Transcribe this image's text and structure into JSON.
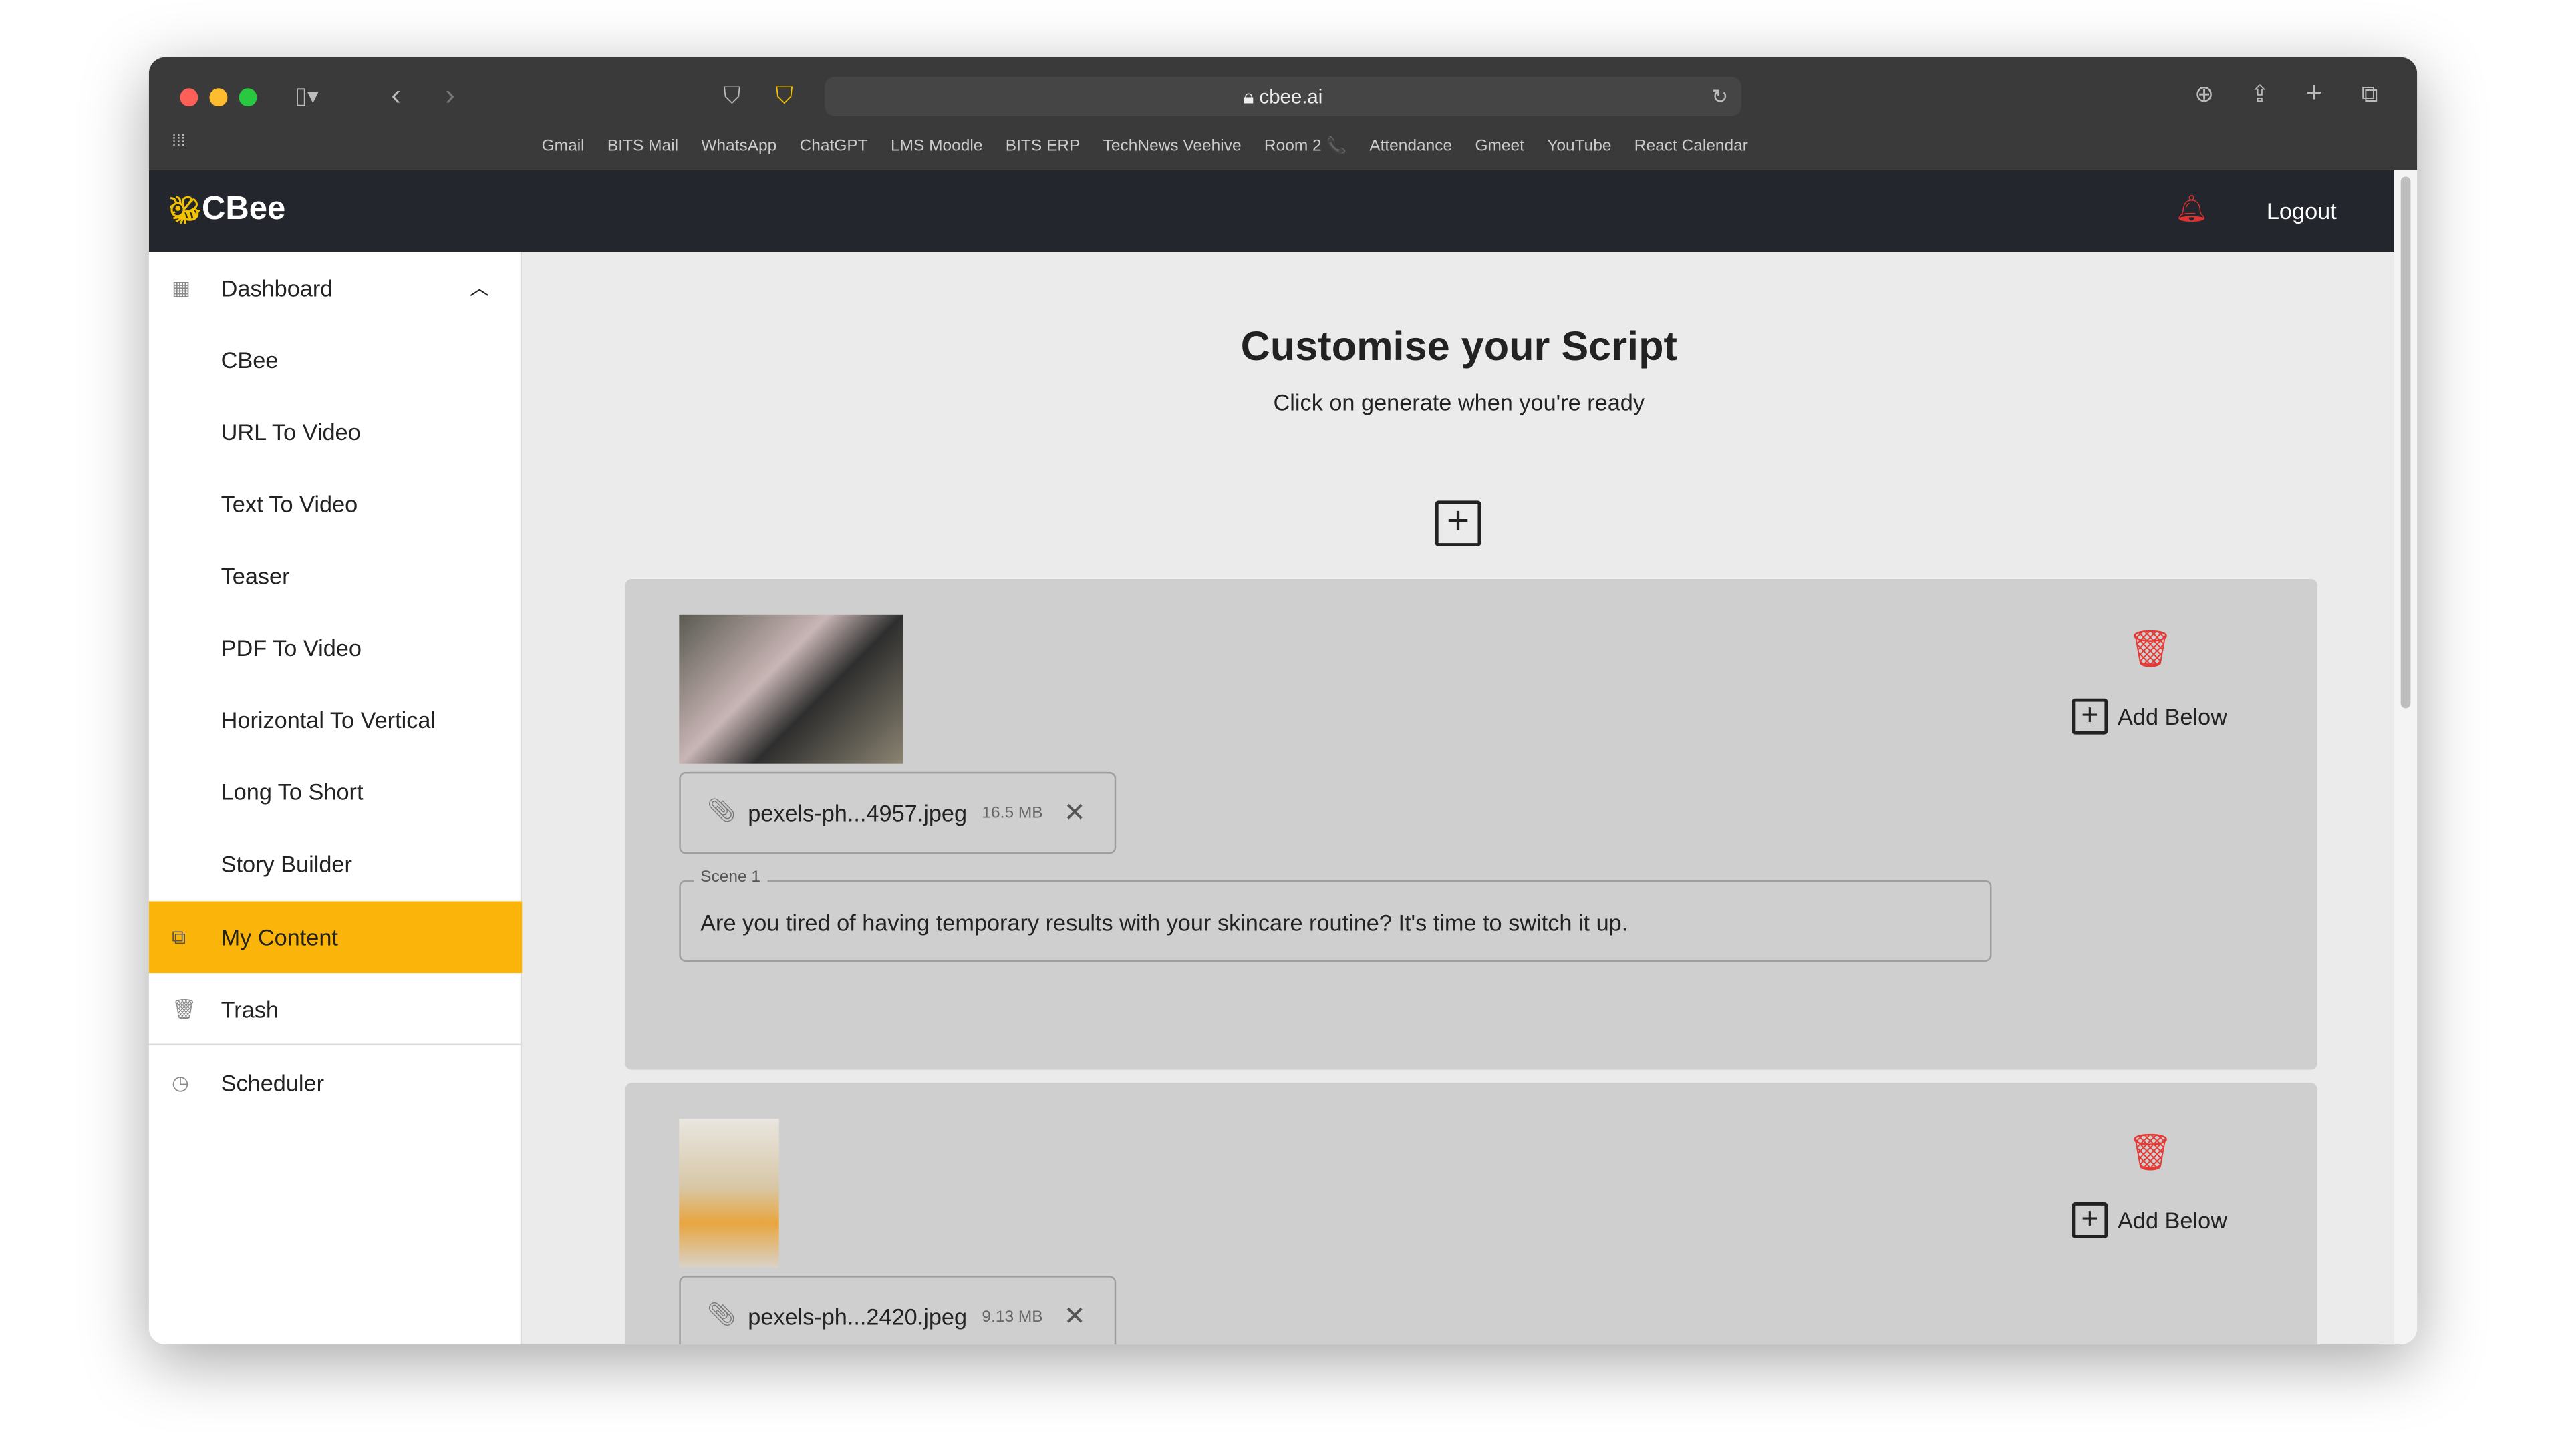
{
  "browser": {
    "url": "cbee.ai",
    "bookmarks": [
      {
        "icon": "gmail-icon",
        "label": "Gmail"
      },
      {
        "icon": "note-icon",
        "label": "BITS Mail"
      },
      {
        "icon": "whatsapp-icon",
        "label": "WhatsApp"
      },
      {
        "icon": "grad-cap-icon",
        "label": "ChatGPT"
      },
      {
        "icon": "books-icon",
        "label": "LMS Moodle"
      },
      {
        "icon": "grad-cap-icon",
        "label": "BITS ERP"
      },
      {
        "icon": "folder-icon",
        "label": "TechNews Veehive"
      },
      {
        "icon": "",
        "label": "Room 2 📞"
      },
      {
        "icon": "page-icon",
        "label": "Attendance"
      },
      {
        "icon": "runner-icon",
        "label": "Gmeet"
      },
      {
        "icon": "",
        "label": "YouTube"
      },
      {
        "icon": "",
        "label": "React Calendar"
      }
    ]
  },
  "header": {
    "logo": "CBee",
    "logout": "Logout"
  },
  "sidebar": {
    "dashboard": "Dashboard",
    "items": [
      "CBee",
      "URL To Video",
      "Text To Video",
      "Teaser",
      "PDF To Video",
      "Horizontal To Vertical",
      "Long To Short",
      "Story Builder"
    ],
    "my_content": "My Content",
    "trash": "Trash",
    "scheduler": "Scheduler"
  },
  "main": {
    "title": "Customise your Script",
    "subtitle": "Click on generate when you're ready",
    "scenes": [
      {
        "file": "pexels-ph...4957.jpeg",
        "size": "16.5 MB",
        "label": "Scene 1",
        "text": "Are you tired of having temporary results with your skincare routine? It's time to switch it up.",
        "add_below": "Add Below"
      },
      {
        "file": "pexels-ph...2420.jpeg",
        "size": "9.13 MB",
        "add_below": "Add Below"
      }
    ]
  },
  "colors": {
    "accent": "#fbb50a",
    "header": "#23262d",
    "delete": "#e53935"
  }
}
